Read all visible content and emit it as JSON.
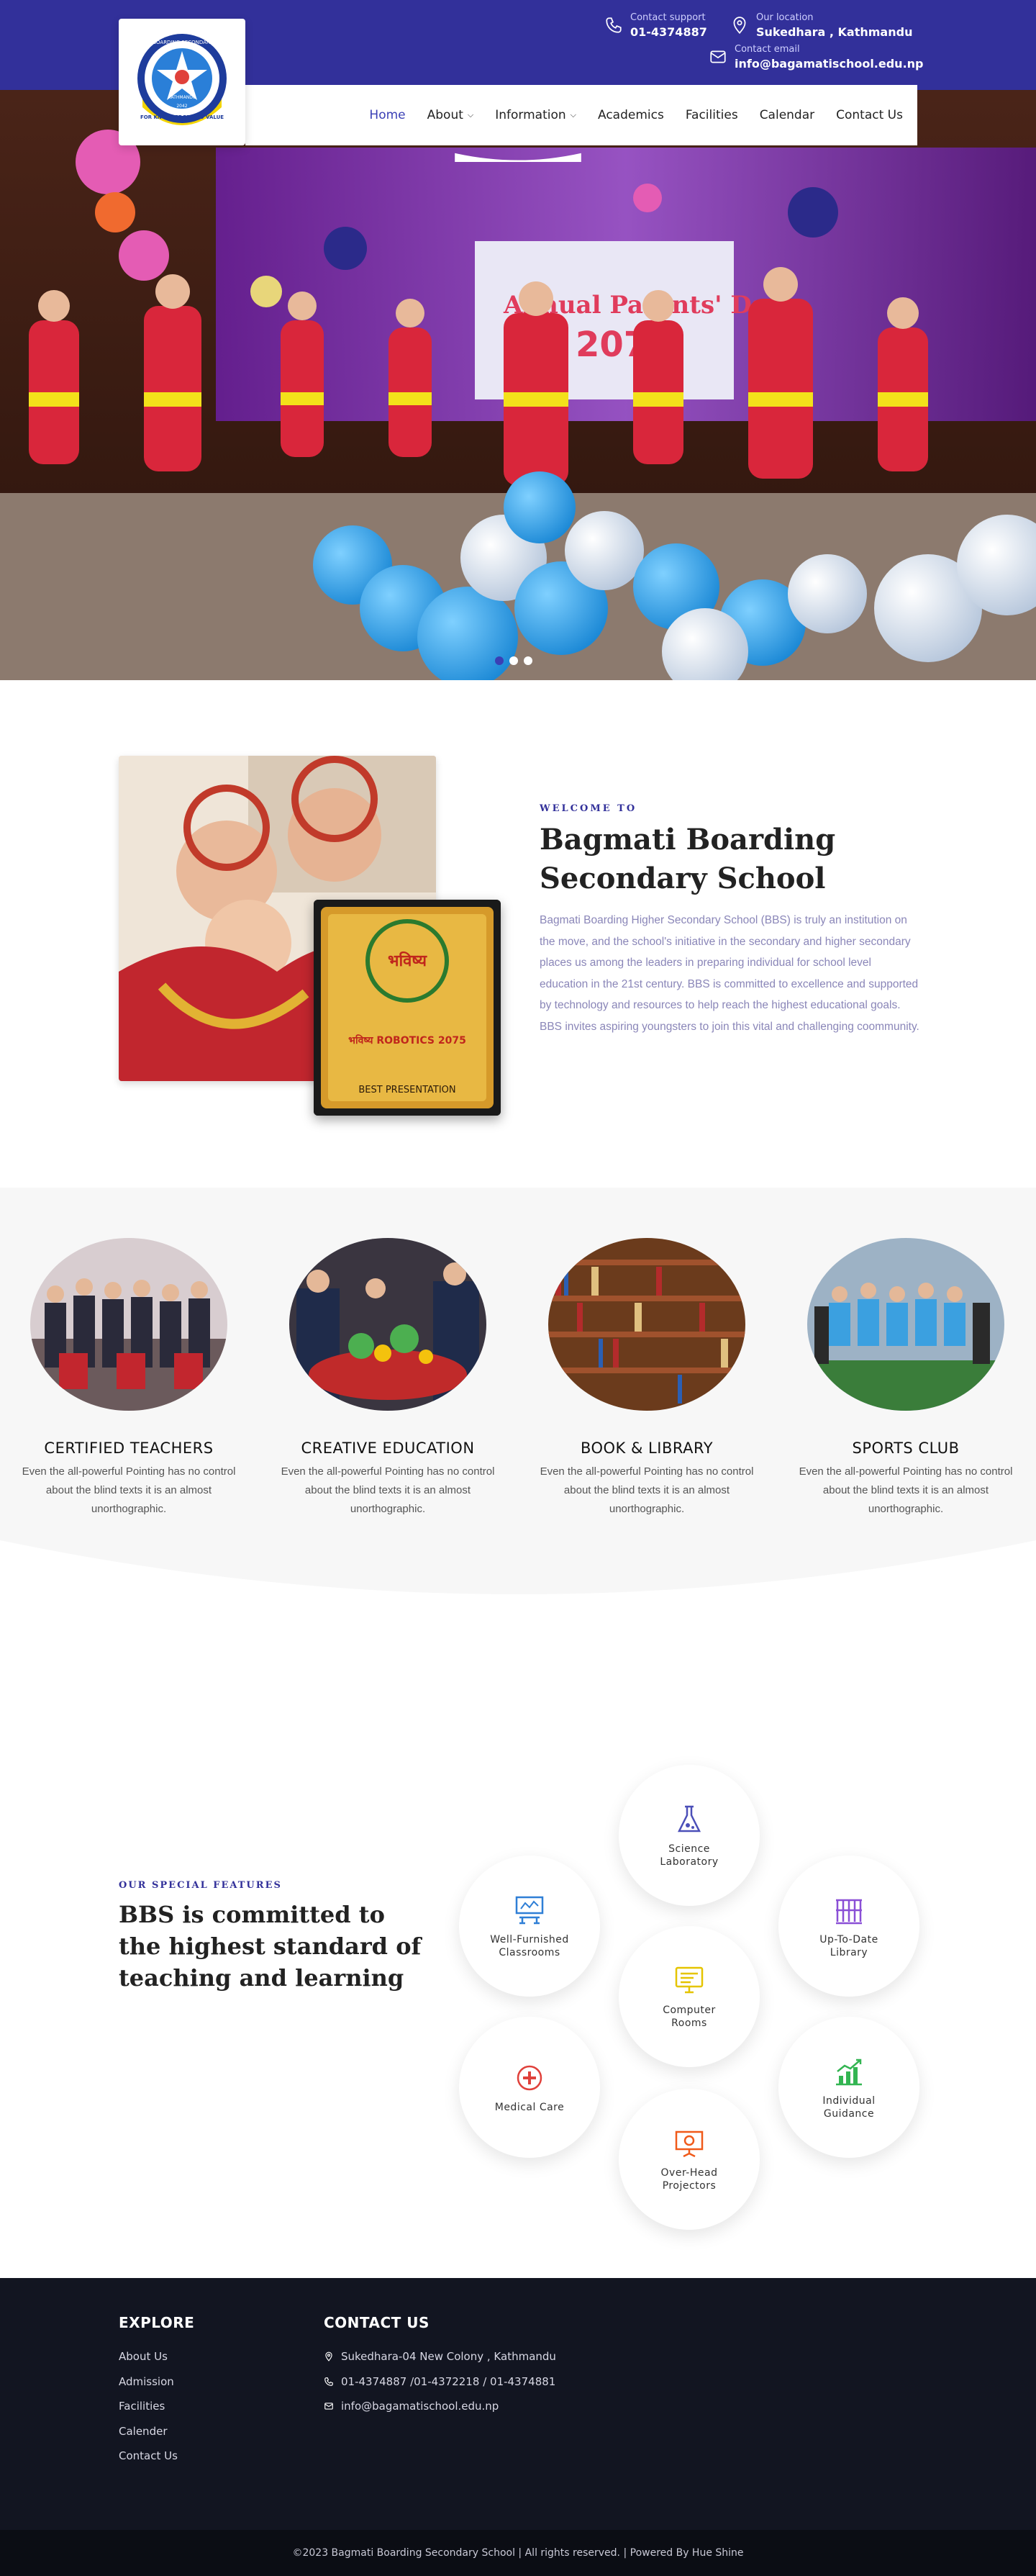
{
  "header": {
    "support": {
      "label": "Contact support",
      "value": "01-4374887",
      "icon": "phone-icon"
    },
    "location": {
      "label": "Our location",
      "value": "Sukedhara , Kathmandu",
      "icon": "location-pin-icon"
    },
    "email": {
      "label": "Contact email",
      "value": "info@bagamatischool.edu.np",
      "icon": "mail-icon"
    },
    "logo": {
      "ring_text": "BAGMATI BOARDING SECONDARY SCHOOL",
      "city": "KATHMANDU",
      "motto": "FOR KNOWLEDGE AND VALUE",
      "year": "2042"
    },
    "brand_color": "#32309a"
  },
  "nav": {
    "items": [
      {
        "label": "Home",
        "active": true,
        "dropdown": false
      },
      {
        "label": "About",
        "active": false,
        "dropdown": true
      },
      {
        "label": "Information",
        "active": false,
        "dropdown": true
      },
      {
        "label": "Academics",
        "active": false,
        "dropdown": false
      },
      {
        "label": "Facilities",
        "active": false,
        "dropdown": false
      },
      {
        "label": "Calendar",
        "active": false,
        "dropdown": false
      },
      {
        "label": "Contact Us",
        "active": false,
        "dropdown": false
      }
    ],
    "caret": "⌄"
  },
  "hero": {
    "banner_text": "Annual Parents' Day",
    "banner_year": "2079",
    "slides": 3,
    "active_slide": 1
  },
  "welcome": {
    "eyebrow": "WELCOME TO",
    "title_line1": "Bagmati Boarding",
    "title_line2": "Secondary School",
    "body": "Bagmati Boarding Higher Secondary School (BBS) is truly an institution on the move, and the school's initiative in the secondary and higher secondary places us among the leaders in preparing individual for school level education in the 21st century. BBS is committed to excellence and supported by technology and resources to help reach the highest educational goals. BBS invites aspiring youngsters to join this vital and challenging coommunity.",
    "award": {
      "name": "भविष्य",
      "event": "भविष्य ROBOTICS 2075",
      "prize": "BEST PRESENTATION"
    }
  },
  "features": [
    {
      "title": "CERTIFIED TEACHERS",
      "text": "Even the all-powerful Pointing has no control about the blind texts it is an almost unorthographic."
    },
    {
      "title": "CREATIVE EDUCATION",
      "text": "Even the all-powerful Pointing has no control about the blind texts it is an almost unorthographic."
    },
    {
      "title": "BOOK & LIBRARY",
      "text": "Even the all-powerful Pointing has no control about the blind texts it is an almost unorthographic."
    },
    {
      "title": "SPORTS CLUB",
      "text": "Even the all-powerful Pointing has no control about the blind texts it is an almost unorthographic."
    }
  ],
  "special": {
    "eyebrow": "OUR SPECIAL FEATURES",
    "title_line1": "BBS is committed to",
    "title_line2": "the highest standard of",
    "title_line3": "teaching and learning",
    "items": [
      {
        "label": "Science Laboratory",
        "icon": "flask-icon",
        "color": "#4b4fb8"
      },
      {
        "label": "Well-Furnished Classrooms",
        "icon": "classroom-icon",
        "color": "#2f7fd6"
      },
      {
        "label": "Up-To-Date Library",
        "icon": "library-icon",
        "color": "#8a4fd6"
      },
      {
        "label": "Computer Rooms",
        "icon": "computer-icon",
        "color": "#e5c400"
      },
      {
        "label": "Medical Care",
        "icon": "medical-icon",
        "color": "#e0413b"
      },
      {
        "label": "Individual Guidance",
        "icon": "growth-chart-icon",
        "color": "#33b552"
      },
      {
        "label": "Over-Head Projectors",
        "icon": "projector-icon",
        "color": "#f05a1a"
      }
    ]
  },
  "footer": {
    "explore_title": "EXPLORE",
    "links": [
      "About Us",
      "Admission",
      "Facilities",
      "Calender",
      "Contact Us"
    ],
    "contact_title": "CONTACT US",
    "address": "Sukedhara-04 New Colony , Kathmandu",
    "phones": "01-4374887 /01-4372218 / 01-4374881",
    "email": "info@bagamatischool.edu.np",
    "copyright": "©2023 Bagmati Boarding Secondary School | All rights reserved. | Powered By Hue Shine"
  }
}
